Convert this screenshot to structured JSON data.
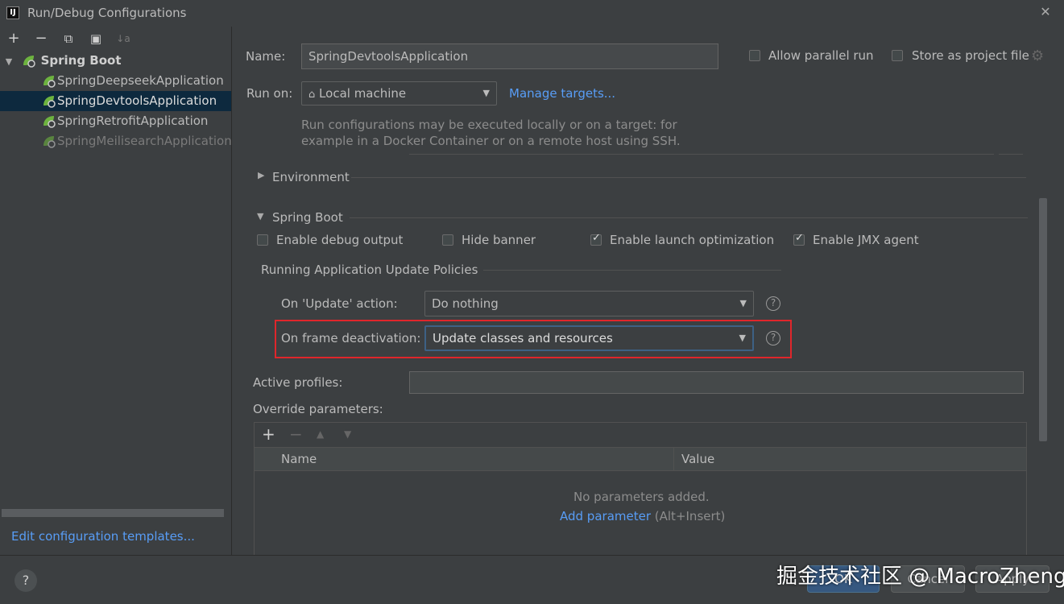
{
  "window": {
    "title": "Run/Debug Configurations",
    "app_icon_text": "IJ"
  },
  "toolbar": {
    "add": "+",
    "remove": "−",
    "copy": "⧉",
    "folder": "▣",
    "sort": "↓a"
  },
  "tree": {
    "group_label": "Spring Boot",
    "items": [
      {
        "label": "SpringDeepseekApplication"
      },
      {
        "label": "SpringDevtoolsApplication"
      },
      {
        "label": "SpringRetrofitApplication"
      },
      {
        "label": "SpringMeilisearchApplication"
      }
    ]
  },
  "left_footer": {
    "edit_templates": "Edit configuration templates..."
  },
  "form": {
    "name_label": "Name:",
    "name_value": "SpringDevtoolsApplication",
    "allow_parallel": "Allow parallel run",
    "store_as_file": "Store as project file",
    "run_on_label": "Run on:",
    "run_on_value": "Local machine",
    "manage_targets": "Manage targets...",
    "run_on_hint_1": "Run configurations may be executed locally or on a target: for",
    "run_on_hint_2": "example in a Docker Container or on a remote host using SSH.",
    "environment_label": "Environment",
    "spring_boot_label": "Spring Boot",
    "enable_debug": "Enable debug output",
    "hide_banner": "Hide banner",
    "enable_launch_opt": "Enable launch optimization",
    "enable_jmx": "Enable JMX agent",
    "policies_label": "Running Application Update Policies",
    "on_update_label": "On 'Update' action:",
    "on_update_value": "Do nothing",
    "on_frame_label": "On frame deactivation:",
    "on_frame_value": "Update classes and resources",
    "active_profiles_label": "Active profiles:",
    "override_label": "Override parameters:",
    "col_name": "Name",
    "col_value": "Value",
    "no_params": "No parameters added.",
    "add_param": "Add parameter",
    "add_param_hint": "(Alt+Insert)"
  },
  "checkbox_state": {
    "enable_debug": false,
    "hide_banner": false,
    "enable_launch_opt": true,
    "enable_jmx": true
  },
  "buttons": {
    "ok": "OK",
    "cancel": "Cancel",
    "apply": "Apply"
  },
  "watermark": "掘金技术社区 @ MacroZheng",
  "colors": {
    "accent": "#589df6",
    "highlight_box": "#e0262b",
    "selection": "#0d293e",
    "spring_green": "#6db33f"
  }
}
